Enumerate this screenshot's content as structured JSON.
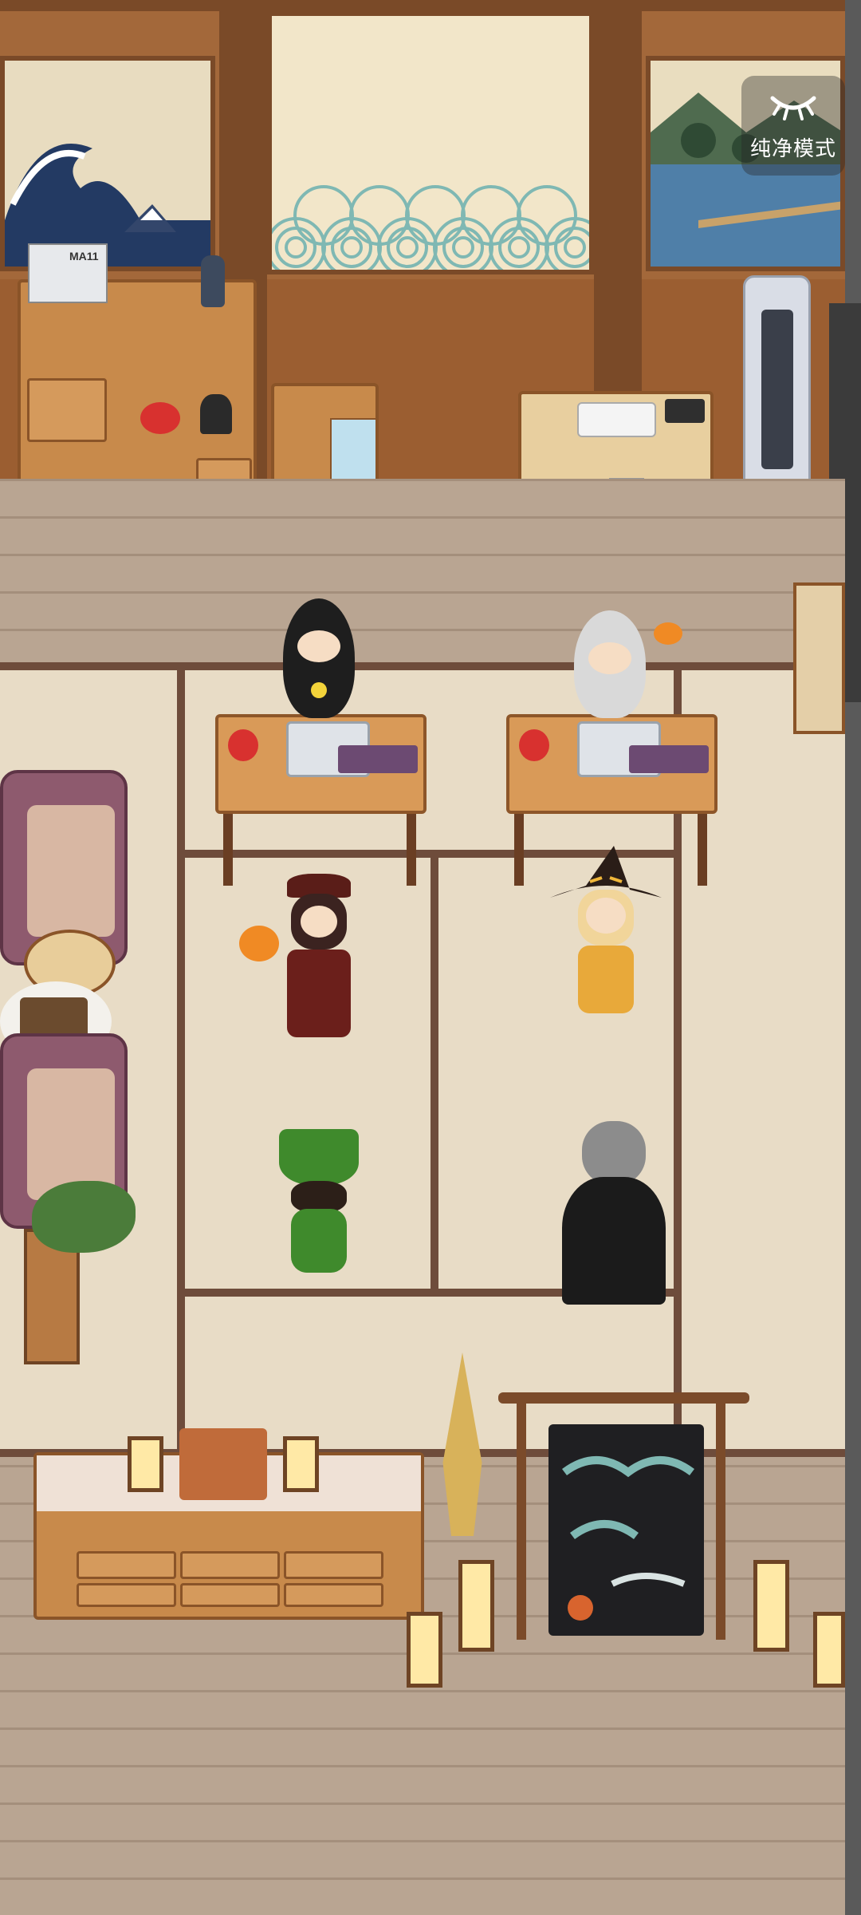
{
  "hud": {
    "pure_mode_label": "纯净模式",
    "pure_mode_icon": "closed-eye-icon"
  },
  "scene": {
    "magazine_text": "MA11",
    "accent_colors": {
      "wall": "#a3683a",
      "tatami": "#e8dcc6",
      "wood_floor": "#b9a592",
      "tatami_border": "#6e4c3b"
    }
  }
}
